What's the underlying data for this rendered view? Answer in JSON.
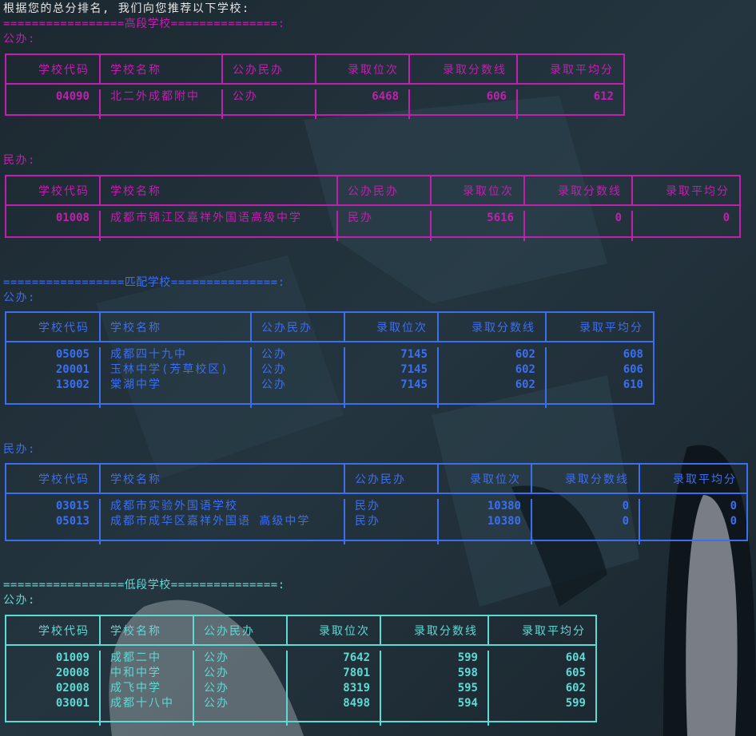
{
  "intro": "根据您的总分排名, 我们向您推荐以下学校:",
  "headers": [
    "学校代码",
    "学校名称",
    "公办民办",
    "录取位次",
    "录取分数线",
    "录取平均分"
  ],
  "colors": {
    "high": "#c21fb0",
    "match": "#3c6ef0",
    "low": "#5fd9d4",
    "background": "#1f2c36"
  },
  "sections": [
    {
      "title": "=================高段学校===============:",
      "groups": [
        {
          "label": "公办:",
          "rows": [
            [
              "04090",
              "北二外成都附中",
              "公办",
              "6468",
              "606",
              "612"
            ]
          ]
        },
        {
          "label": "民办:",
          "rows": [
            [
              "01008",
              "成都市锦江区嘉祥外国语高级中学",
              "民办",
              "5616",
              "0",
              "0"
            ]
          ]
        }
      ]
    },
    {
      "title": "=================匹配学校===============:",
      "groups": [
        {
          "label": "公办:",
          "rows": [
            [
              "05005",
              "成都四十九中",
              "公办",
              "7145",
              "602",
              "608"
            ],
            [
              "20001",
              "玉林中学(芳草校区)",
              "公办",
              "7145",
              "602",
              "606"
            ],
            [
              "13002",
              "棠湖中学",
              "公办",
              "7145",
              "602",
              "610"
            ]
          ]
        },
        {
          "label": "民办:",
          "rows": [
            [
              "03015",
              "成都市实验外国语学校",
              "民办",
              "10380",
              "0",
              "0"
            ],
            [
              "05013",
              "成都市成华区嘉祥外国语 高级中学",
              "民办",
              "10380",
              "0",
              "0"
            ]
          ]
        }
      ]
    },
    {
      "title": "=================低段学校===============:",
      "groups": [
        {
          "label": "公办:",
          "rows": [
            [
              "01009",
              "成都二中",
              "公办",
              "7642",
              "599",
              "604"
            ],
            [
              "20008",
              "中和中学",
              "公办",
              "7801",
              "598",
              "605"
            ],
            [
              "02008",
              "成飞中学",
              "公办",
              "8319",
              "595",
              "602"
            ],
            [
              "03001",
              "成都十八中",
              "公办",
              "8498",
              "594",
              "599"
            ]
          ]
        }
      ]
    }
  ]
}
